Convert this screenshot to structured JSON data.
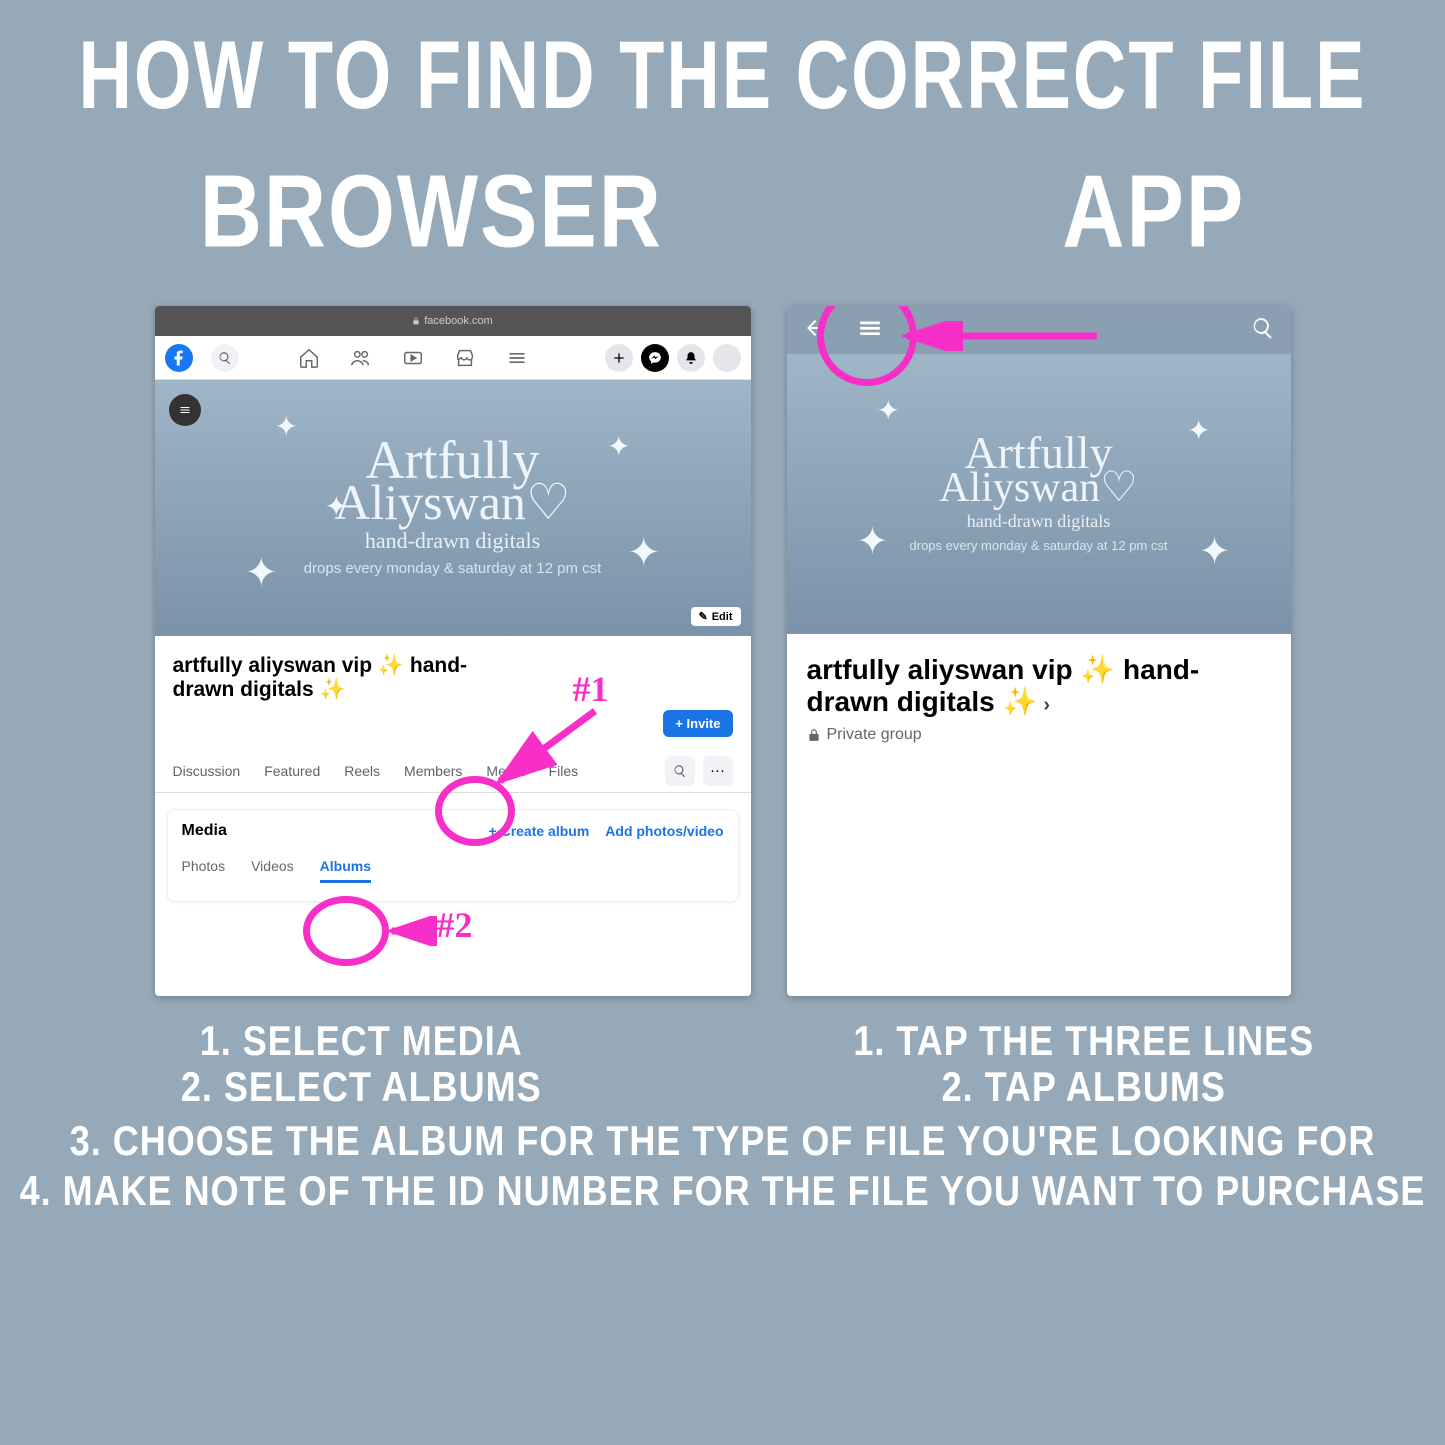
{
  "title": "HOW TO FIND THE CORRECT FILE",
  "columns": {
    "browser": "BROWSER",
    "app": "APP"
  },
  "url_label": "facebook.com",
  "cover": {
    "script_line1": "Artfully",
    "script_line2": "Aliyswan",
    "handdrawn": "hand-drawn digitals",
    "drops": "drops every monday & saturday at 12 pm cst"
  },
  "group_name": "artfully aliyswan vip ✨ hand-drawn digitals ✨",
  "edit_label": "Edit",
  "invite_label": "+ Invite",
  "tabs": [
    "Discussion",
    "Featured",
    "Reels",
    "Members",
    "Media",
    "Files"
  ],
  "media_section": {
    "title": "Media",
    "create": "+  Create album",
    "add": "Add photos/video",
    "subtabs": [
      "Photos",
      "Videos",
      "Albums"
    ]
  },
  "annotations": {
    "one": "#1",
    "two": "#2"
  },
  "app": {
    "private": "Private group"
  },
  "instructions": {
    "browser_1": "1. SELECT MEDIA",
    "browser_2": "2. SELECT ALBUMS",
    "app_1": "1. TAP THE THREE LINES",
    "app_2": "2. TAP ALBUMS",
    "full_3": "3. CHOOSE THE ALBUM FOR THE TYPE OF FILE YOU'RE LOOKING FOR",
    "full_4": "4. MAKE NOTE OF THE ID NUMBER FOR THE FILE YOU WANT TO PURCHASE"
  }
}
